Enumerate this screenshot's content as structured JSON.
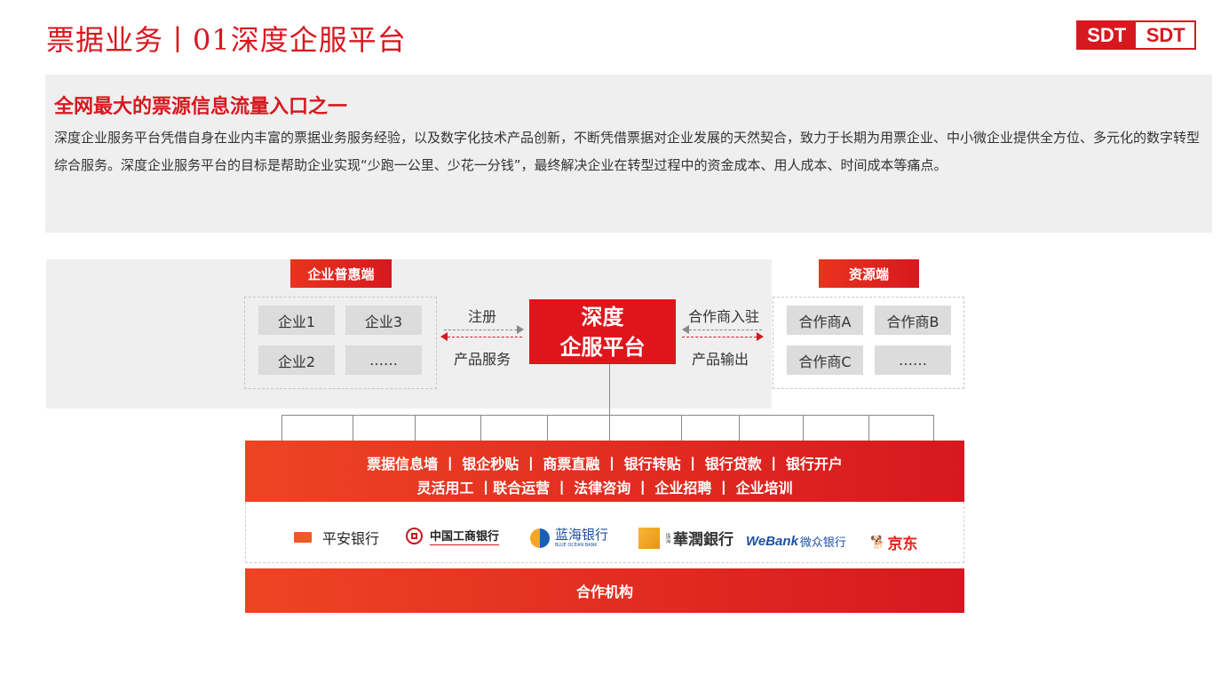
{
  "header": {
    "title": "票据业务丨01深度企服平台",
    "logo": [
      "SDT",
      "SDT"
    ]
  },
  "intro": {
    "heading": "全网最大的票源信息流量入口之一",
    "body": "深度企业服务平台凭借自身在业内丰富的票据业务服务经验，以及数字化技术产品创新，不断凭借票据对企业发展的天然契合，致力于长期为用票企业、中小微企业提供全方位、多元化的数字转型综合服务。深度企业服务平台的目标是帮助企业实现“少跑一公里、少花一分钱”，最终解决企业在转型过程中的资金成本、用人成本、时间成本等痛点。"
  },
  "diagram": {
    "left_tag": "企业普惠端",
    "right_tag": "资源端",
    "left_items": [
      "企业1",
      "企业3",
      "企业2",
      "……"
    ],
    "right_items": [
      "合作商A",
      "合作商B",
      "合作商C",
      "……"
    ],
    "platform": [
      "深度",
      "企服平台"
    ],
    "left_top_label": "注册",
    "left_bottom_label": "产品服务",
    "right_top_label": "合作商入驻",
    "right_bottom_label": "产品输出"
  },
  "services": {
    "row1": "票据信息墙  丨 银企秒贴  丨 商票直融  丨 银行转贴  丨 银行贷款  丨 银行开户",
    "row2": "灵活用工  丨联合运营  丨 法律咨询  丨 企业招聘  丨  企业培训"
  },
  "partners": {
    "pingan": "平安银行",
    "icbc": "中国工商银行",
    "lanhai": "蓝海银行",
    "lanhai_en": "BLUE OCEAN BANK",
    "huarun_small": "珠海",
    "huarun": "華潤銀行",
    "webank": "WeBank",
    "webank_cn": "微众银行",
    "jd": "京东"
  },
  "footer": {
    "label": "合作机构"
  },
  "colors": {
    "brand_red": "#d7181f",
    "panel_gray": "#efefef",
    "chip_gray": "#dcdcdc"
  }
}
